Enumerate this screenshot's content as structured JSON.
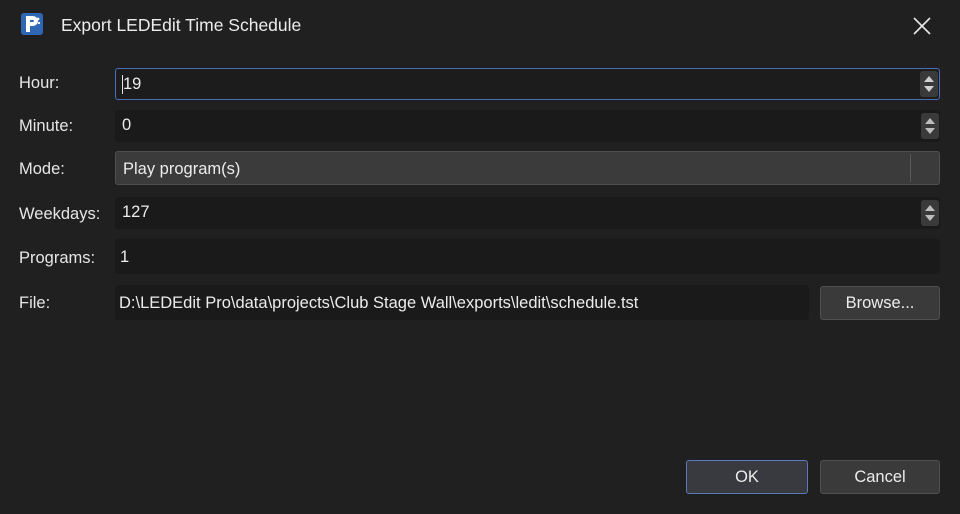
{
  "window": {
    "title": "Export LEDEdit Time Schedule",
    "close_icon": "close-icon",
    "app_icon": "ledit-app-icon"
  },
  "form": {
    "hour": {
      "label": "Hour:",
      "value": "19"
    },
    "minute": {
      "label": "Minute:",
      "value": "0"
    },
    "mode": {
      "label": "Mode:",
      "selected": "Play program(s)"
    },
    "weekdays": {
      "label": "Weekdays:",
      "value": "127"
    },
    "programs": {
      "label": "Programs:",
      "value": "1"
    },
    "file": {
      "label": "File:",
      "value": "D:\\LEDEdit Pro\\data\\projects\\Club Stage Wall\\exports\\ledit\\schedule.tst",
      "browse_label": "Browse..."
    }
  },
  "buttons": {
    "ok": "OK",
    "cancel": "Cancel"
  },
  "colors": {
    "background": "#202020",
    "focus_border": "#4a6fb2",
    "field_bg": "#1a1a1a"
  }
}
